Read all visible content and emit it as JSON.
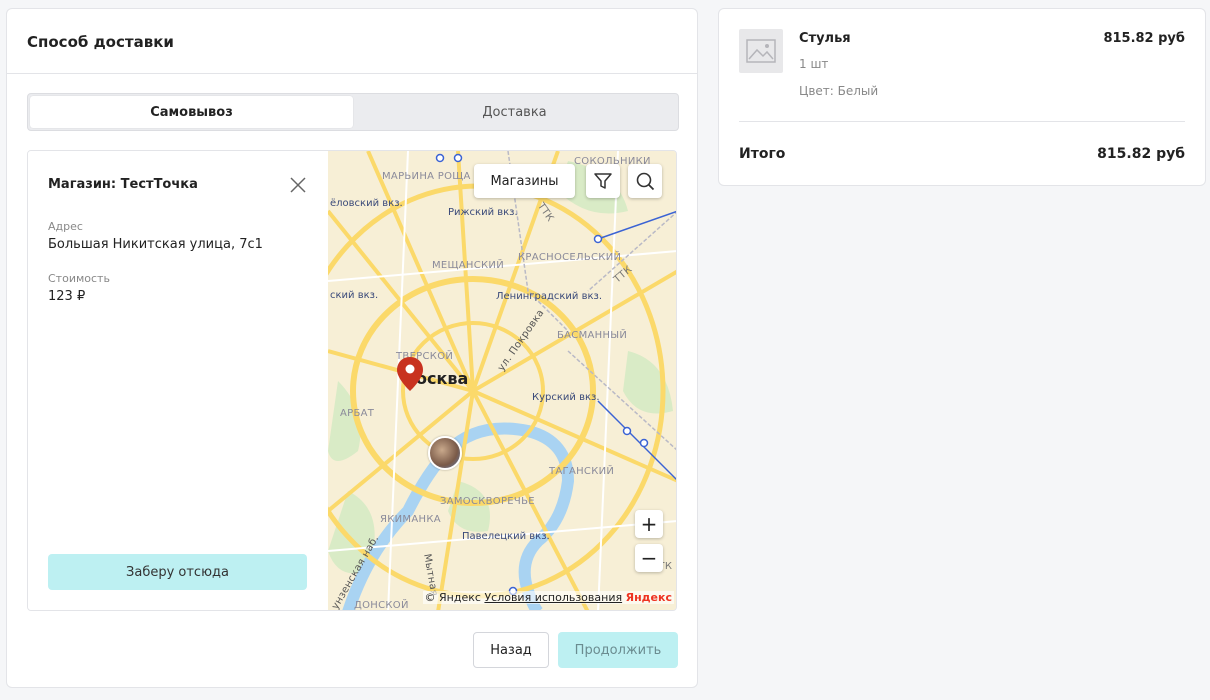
{
  "delivery": {
    "title": "Способ доставки",
    "tabs": [
      {
        "label": "Самовывоз",
        "active": true
      },
      {
        "label": "Доставка",
        "active": false
      }
    ],
    "store": {
      "name": "Магазин: ТестТочка",
      "address_label": "Адрес",
      "address": "Большая Никитская улица, 7с1",
      "cost_label": "Стоимость",
      "cost": "123 ₽",
      "pick_button": "Заберу отсюда"
    },
    "map": {
      "stores_button": "Магазины",
      "zoom_in": "+",
      "zoom_out": "−",
      "copyright": "© Яндекс",
      "terms": "Условия использования",
      "brand": "Яндекс",
      "city": "осква",
      "districts": [
        "МАРЬИНА РОЩА",
        "СОКОЛЬНИКИ",
        "МЕЩАНСКИЙ",
        "КРАСНОСЕЛЬСКИЙ",
        "БАСМАННЫЙ",
        "ТВЕРСКОЙ",
        "АРБАТ",
        "ТАГАНСКИЙ",
        "ЗАМОСКВОРЕЧЬЕ",
        "ЯКИМАНКА",
        "ДОНСКОЙ"
      ],
      "stations": [
        "ёловский вкз.",
        "Рижский вкз.",
        "ский вкз.",
        "Ленинградский вкз.",
        "Курский вкз.",
        "Павелецкий вкз."
      ],
      "streets": [
        "ул. Покровка",
        "Мытная",
        "унзенская наб."
      ],
      "ring_labels": [
        "ТТК",
        "ТТК",
        "ТТК"
      ]
    },
    "back_button": "Назад",
    "continue_button": "Продолжить"
  },
  "summary": {
    "item": {
      "name": "Стулья",
      "quantity": "1 шт",
      "color": "Цвет: Белый",
      "price": "815.82 руб"
    },
    "total_label": "Итого",
    "total_value": "815.82 руб"
  },
  "colors": {
    "accent": "#bdf0f2",
    "marker": "#c8321f",
    "map_bg": "#f7efd6",
    "road": "#fbd96a",
    "water": "#a9d3f2",
    "park": "#d9ebc6"
  }
}
